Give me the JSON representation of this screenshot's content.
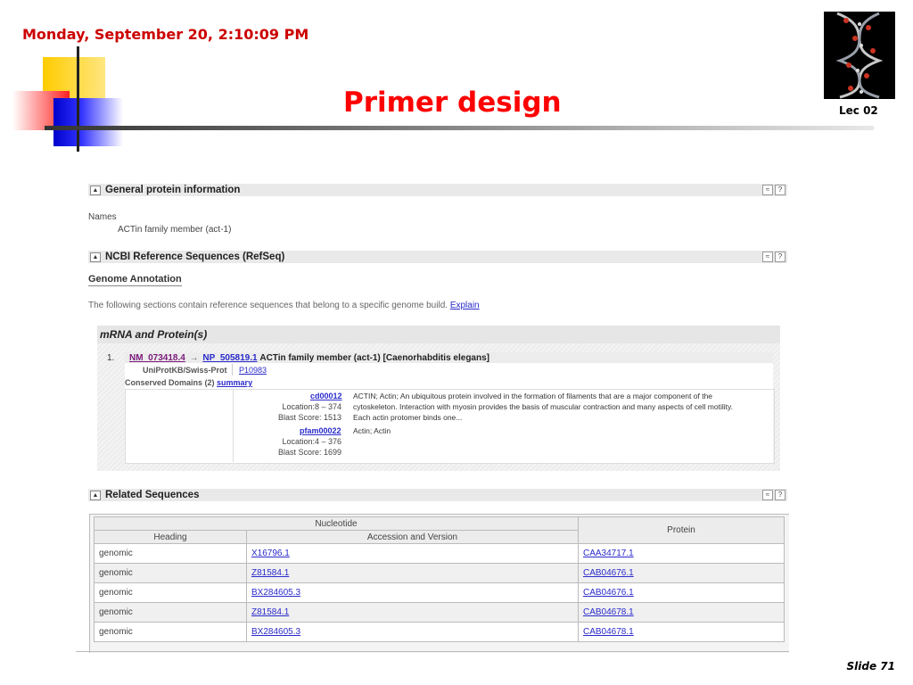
{
  "slide": {
    "date": "Monday, September 20, 2:10:09 PM",
    "title": "Primer design",
    "lec": "Lec 02",
    "footer": "Slide 71"
  },
  "screenshot": {
    "general": {
      "heading": "General protein information",
      "names_label": "Names",
      "names_value": "ACTin family member (act-1)"
    },
    "refseq": {
      "heading": "NCBI Reference Sequences (RefSeq)",
      "genome_annotation": "Genome Annotation",
      "intro": "The following sections contain reference sequences that belong to a specific genome build.",
      "explain": "Explain"
    },
    "mrna": {
      "heading": "mRNA and Protein(s)",
      "item_number": "1.",
      "nm": "NM_073418.4",
      "arrow": "→",
      "np": "NP_505819.1",
      "desc": "ACTin family member (act-1) [Caenorhabditis elegans]",
      "uniprot_label": "UniProtKB/Swiss-Prot",
      "uniprot_value": "P10983",
      "conserved_label": "Conserved Domains (2)",
      "summary": "summary",
      "domains": [
        {
          "id": "cd00012",
          "location": "Location:8 – 374",
          "score": "Blast Score: 1513",
          "desc_lines": [
            "ACTIN; Actin; An ubiquitous protein involved in the formation of filaments that are a major component of the",
            "cytoskeleton. Interaction with myosin provides the basis of muscular contraction and many aspects of cell motility.",
            "Each actin protomer binds one..."
          ]
        },
        {
          "id": "pfam00022",
          "location": "Location:4 – 376",
          "score": "Blast Score: 1699",
          "desc_lines": [
            "Actin; Actin"
          ]
        }
      ]
    },
    "related": {
      "heading": "Related Sequences",
      "col_group": "Nucleotide",
      "col_heading": "Heading",
      "col_accession": "Accession and Version",
      "col_protein": "Protein",
      "rows": [
        {
          "heading": "genomic",
          "accession": "X16796.1",
          "protein": "CAA34717.1"
        },
        {
          "heading": "genomic",
          "accession": "Z81584.1",
          "protein": "CAB04676.1"
        },
        {
          "heading": "genomic",
          "accession": "BX284605.3",
          "protein": "CAB04676.1"
        },
        {
          "heading": "genomic",
          "accession": "Z81584.1",
          "protein": "CAB04678.1"
        },
        {
          "heading": "genomic",
          "accession": "BX284605.3",
          "protein": "CAB04678.1"
        }
      ]
    },
    "icons": {
      "collapse": "▲",
      "top": "≈",
      "help": "?"
    }
  }
}
